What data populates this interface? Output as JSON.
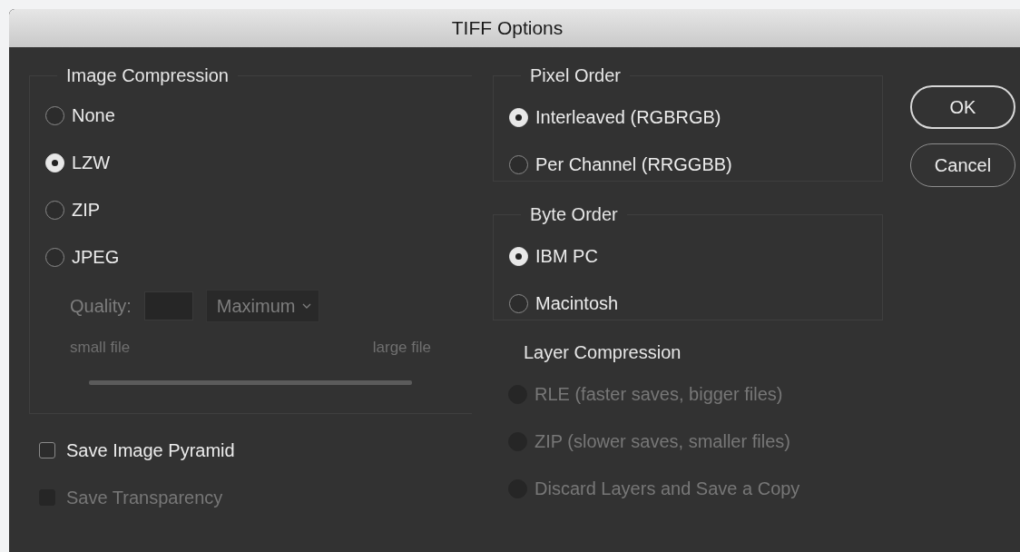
{
  "window": {
    "title": "TIFF Options"
  },
  "image_compression": {
    "title": "Image Compression",
    "options": [
      {
        "label": "None",
        "selected": false
      },
      {
        "label": "LZW",
        "selected": true
      },
      {
        "label": "ZIP",
        "selected": false
      },
      {
        "label": "JPEG",
        "selected": false
      }
    ],
    "quality": {
      "label": "Quality:",
      "preset": "Maximum",
      "disabled": true,
      "min_label": "small file",
      "max_label": "large file"
    }
  },
  "checkboxes": [
    {
      "label": "Save Image Pyramid",
      "checked": false,
      "disabled": false
    },
    {
      "label": "Save Transparency",
      "checked": false,
      "disabled": true
    }
  ],
  "pixel_order": {
    "title": "Pixel Order",
    "options": [
      {
        "label": "Interleaved (RGBRGB)",
        "selected": true
      },
      {
        "label": "Per Channel (RRGGBB)",
        "selected": false
      }
    ]
  },
  "byte_order": {
    "title": "Byte Order",
    "options": [
      {
        "label": "IBM PC",
        "selected": true
      },
      {
        "label": "Macintosh",
        "selected": false
      }
    ]
  },
  "layer_compression": {
    "title": "Layer Compression",
    "options": [
      {
        "label": "RLE (faster saves, bigger files)",
        "selected": false,
        "disabled": true
      },
      {
        "label": "ZIP (slower saves, smaller files)",
        "selected": false,
        "disabled": true
      },
      {
        "label": "Discard Layers and Save a Copy",
        "selected": false,
        "disabled": true
      }
    ]
  },
  "buttons": [
    {
      "label": "OK",
      "default": true
    },
    {
      "label": "Cancel",
      "default": false
    }
  ]
}
